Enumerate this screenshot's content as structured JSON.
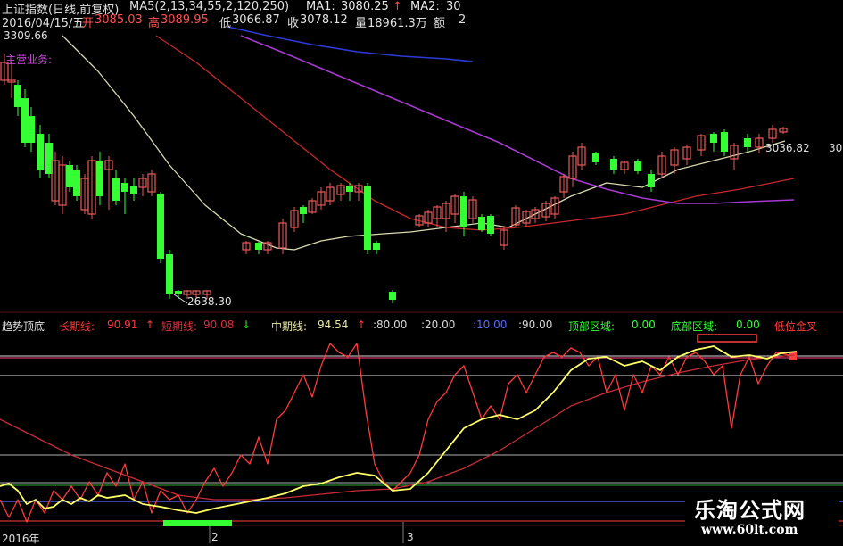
{
  "header": {
    "title": "上证指数(日线,前复权)",
    "ma_params": "MA5(2,13,34,55,2,120,250)",
    "ma1_label": "MA1:",
    "ma1_value": "3080.25",
    "ma1_arrow": "↑",
    "ma2_label": "MA2:",
    "ma2_value": "30",
    "date": "2016/04/15/五",
    "open_label": "开",
    "open_value": "3085.03",
    "high_label": "高",
    "high_value": "3089.95",
    "low_label": "低",
    "low_value": "3066.87",
    "close_label": "收",
    "close_value": "3078.12",
    "volume_label": "量",
    "volume_value": "18961.3万",
    "amount_label": "额",
    "amount_value": "2"
  },
  "main_chart": {
    "high_marker": "3309.66",
    "low_marker": "2638.30",
    "main_business": "主营业务:",
    "current_price": "3036.82",
    "current_price_extra": "30"
  },
  "indicator": {
    "name": "趋势顶底",
    "long_label": "长期线:",
    "long_value": "90.91",
    "long_arrow": "↑",
    "short_label": "短期线:",
    "short_value": "90.08",
    "short_arrow": "↓",
    "mid_label": "中期线:",
    "mid_value": "94.54",
    "mid_arrow": "↑",
    "level_80": ":80.00",
    "level_20": ":20.00",
    "level_10": ":10.00",
    "level_90": ":90.00",
    "top_zone_label": "顶部区域:",
    "top_zone_value": "0.00",
    "bottom_zone_label": "底部区域:",
    "bottom_zone_value": "0.00",
    "low_golden": "低位金叉"
  },
  "time_axis": {
    "labels": [
      "2016年",
      "2",
      "3"
    ]
  },
  "watermark": {
    "name": "乐淘公式网",
    "url": "www.60lt.com"
  },
  "colors": {
    "background": "#000000",
    "up_candle": "#e85a5a",
    "down_candle": "#33ff33",
    "ma_white": "#d8d8b0",
    "ma_red": "#c8282c",
    "ma_purple": "#a63ad0",
    "ma_blue": "#2c3ad8",
    "long_line": "#ff3a3a",
    "short_line": "#c82a38",
    "mid_line": "#ffff66",
    "grid_line": "#8a1418"
  },
  "chart_data": {
    "type": "line",
    "title": "上证指数(日线,前复权)",
    "candles": {
      "count": 66,
      "highest": 3309.66,
      "lowest": 2638.3,
      "last_close": 3078.12
    },
    "indicator_series": [
      {
        "name": "长期线",
        "last_value": 90.91
      },
      {
        "name": "短期线",
        "last_value": 90.08
      },
      {
        "name": "中期线",
        "last_value": 94.54
      }
    ],
    "reference_levels": [
      80,
      20,
      10,
      90
    ]
  }
}
